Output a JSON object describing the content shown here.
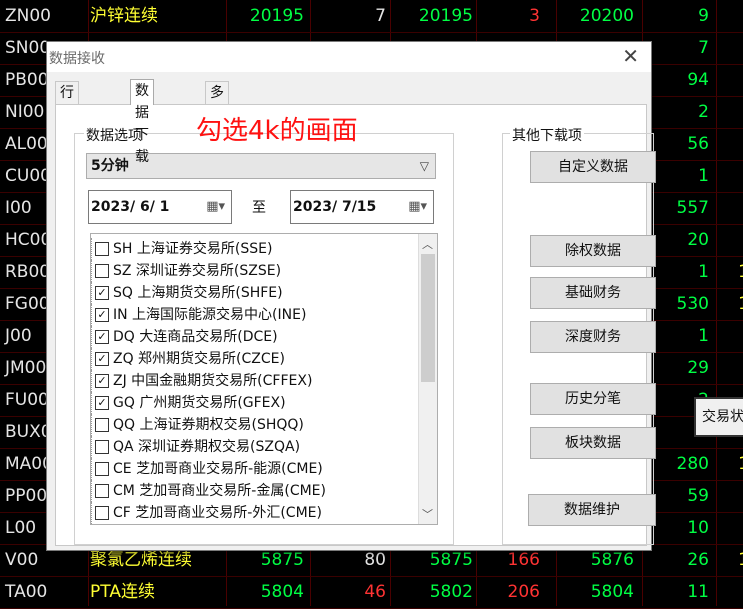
{
  "rows": [
    {
      "code": "ZN00",
      "name": "沪锌连续",
      "v1": "20195",
      "v2": "7",
      "v3": "20195",
      "v4": "3",
      "v5": "20200",
      "v6": "9",
      "v7": "",
      "v2_up": false,
      "v4_up": true
    },
    {
      "code": "SN00",
      "name": "",
      "v1": "",
      "v2": "",
      "v3": "",
      "v4": "",
      "v5": "",
      "v6": "7",
      "v7": ""
    },
    {
      "code": "PB00",
      "name": "",
      "v1": "",
      "v2": "",
      "v3": "",
      "v4": "",
      "v5": "",
      "v6": "94",
      "v7": ""
    },
    {
      "code": "NI00",
      "name": "",
      "v1": "",
      "v2": "",
      "v3": "",
      "v4": "",
      "v5": "",
      "v6": "2",
      "v7": ""
    },
    {
      "code": "AL00",
      "name": "",
      "v1": "",
      "v2": "",
      "v3": "",
      "v4": "",
      "v5": "",
      "v6": "56",
      "v7": ""
    },
    {
      "code": "CU00",
      "name": "",
      "v1": "",
      "v2": "",
      "v3": "",
      "v4": "",
      "v5": "",
      "v6": "1",
      "v7": ""
    },
    {
      "code": "I00",
      "name": "",
      "v1": "",
      "v2": "",
      "v3": "",
      "v4": "",
      "v5": "",
      "v6": "557",
      "v7": ""
    },
    {
      "code": "HC00",
      "name": "",
      "v1": "",
      "v2": "",
      "v3": "",
      "v4": "",
      "v5": "",
      "v6": "20",
      "v7": ""
    },
    {
      "code": "RB00",
      "name": "",
      "v1": "",
      "v2": "",
      "v3": "",
      "v4": "",
      "v5": "",
      "v6": "1",
      "v7": "1"
    },
    {
      "code": "FG00",
      "name": "",
      "v1": "",
      "v2": "",
      "v3": "",
      "v4": "",
      "v5": "",
      "v6": "530",
      "v7": "1"
    },
    {
      "code": "J00",
      "name": "",
      "v1": "",
      "v2": "",
      "v3": "",
      "v4": "",
      "v5": "",
      "v6": "1",
      "v7": ""
    },
    {
      "code": "JM00",
      "name": "",
      "v1": "",
      "v2": "",
      "v3": "",
      "v4": "",
      "v5": "",
      "v6": "29",
      "v7": ""
    },
    {
      "code": "FU00",
      "name": "",
      "v1": "",
      "v2": "",
      "v3": "",
      "v4": "",
      "v5": "",
      "v6": "2",
      "v7": ""
    },
    {
      "code": "BUX0",
      "name": "",
      "v1": "",
      "v2": "",
      "v3": "",
      "v4": "",
      "v5": "",
      "v6": "",
      "v7": ""
    },
    {
      "code": "MA00",
      "name": "",
      "v1": "",
      "v2": "",
      "v3": "",
      "v4": "",
      "v5": "",
      "v6": "280",
      "v7": "1"
    },
    {
      "code": "PP00",
      "name": "",
      "v1": "",
      "v2": "",
      "v3": "",
      "v4": "",
      "v5": "",
      "v6": "59",
      "v7": ""
    },
    {
      "code": "L00",
      "name": "",
      "v1": "",
      "v2": "",
      "v3": "",
      "v4": "",
      "v5": "",
      "v6": "10",
      "v7": ""
    },
    {
      "code": "V00",
      "name": "聚氯乙烯连续",
      "v1": "5875",
      "v2": "80",
      "v3": "5875",
      "v4": "166",
      "v5": "5876",
      "v6": "26",
      "v7": "1",
      "v2_up": false,
      "v4_up": true
    },
    {
      "code": "TA00",
      "name": "PTA连续",
      "v1": "5804",
      "v2": "46",
      "v3": "5802",
      "v4": "206",
      "v5": "5804",
      "v6": "11",
      "v7": "",
      "v2_up": true,
      "v4_up": true
    }
  ],
  "dialog": {
    "title": "数据接收",
    "close": "✕",
    "tabs": [
      "行情连接",
      "数据下载",
      "多档订阅"
    ],
    "group_label": "数据选项",
    "period": "5分钟",
    "date_from": "2023/  6/  1",
    "to_label": "至",
    "date_to": "2023/  7/15",
    "exchanges": [
      {
        "label": "SH 上海证券交易所(SSE)",
        "checked": false
      },
      {
        "label": "SZ 深圳证券交易所(SZSE)",
        "checked": false
      },
      {
        "label": "SQ 上海期货交易所(SHFE)",
        "checked": true
      },
      {
        "label": "IN 上海国际能源交易中心(INE)",
        "checked": true
      },
      {
        "label": "DQ 大连商品交易所(DCE)",
        "checked": true
      },
      {
        "label": "ZQ 郑州期货交易所(CZCE)",
        "checked": true
      },
      {
        "label": "ZJ 中国金融期货交易所(CFFEX)",
        "checked": true
      },
      {
        "label": "GQ 广州期货交易所(GFEX)",
        "checked": true
      },
      {
        "label": "QQ 上海证券期权交易(SHQQ)",
        "checked": false
      },
      {
        "label": "QA 深圳证券期权交易(SZQA)",
        "checked": false
      },
      {
        "label": "CE 芝加哥商业交易所-能源(CME)",
        "checked": false
      },
      {
        "label": "CM 芝加哥商业交易所-金属(CME)",
        "checked": false
      },
      {
        "label": "CF 芝加哥商业交易所-外汇(CME)",
        "checked": false
      }
    ],
    "other_label": "其他下载项",
    "buttons": [
      "自定义数据",
      "除权数据",
      "基础财务",
      "深度财务",
      "历史分笔",
      "板块数据",
      "数据维护"
    ]
  },
  "annotation": "勾选4k的画面",
  "popup": "交易状"
}
